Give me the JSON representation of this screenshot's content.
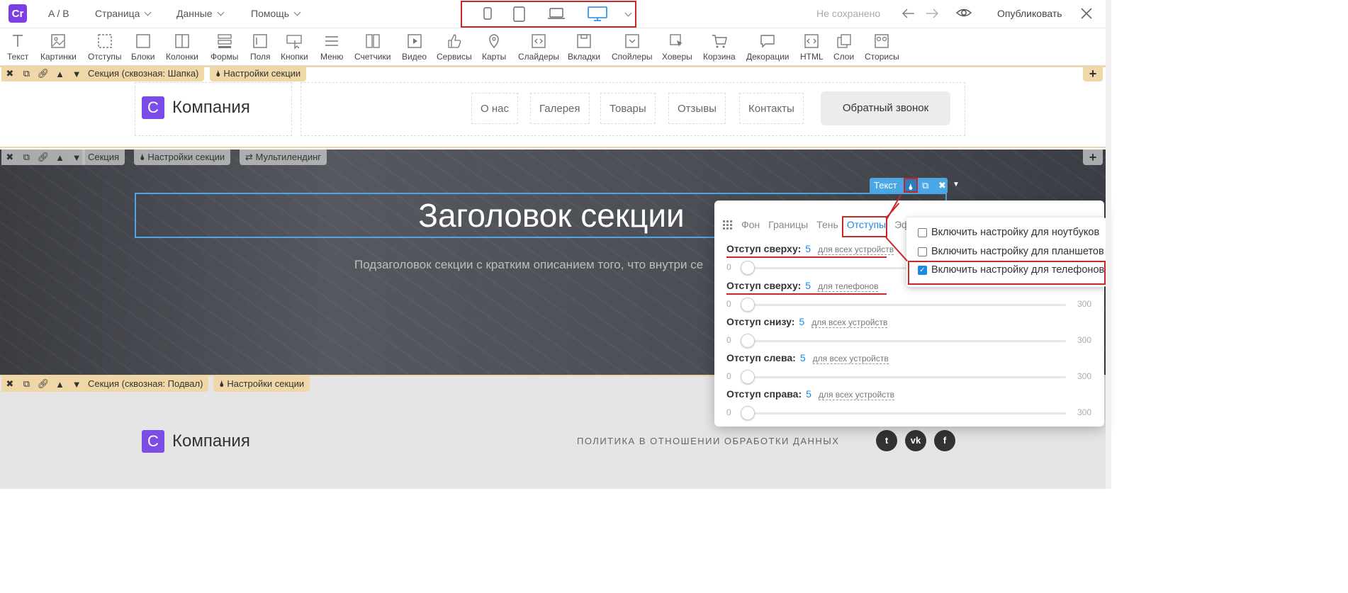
{
  "topbar": {
    "ab": "A / B",
    "menu": [
      "Страница",
      "Данные",
      "Помощь"
    ],
    "save_status": "Не сохранено",
    "publish": "Опубликовать"
  },
  "toolbar": [
    "Текст",
    "Картинки",
    "Отступы",
    "Блоки",
    "Колонки",
    "Формы",
    "Поля",
    "Кнопки",
    "Меню",
    "Счетчики",
    "Видео",
    "Сервисы",
    "Карты",
    "Слайдеры",
    "Вкладки",
    "Спойлеры",
    "Ховеры",
    "Корзина",
    "Декорации",
    "HTML",
    "Слои",
    "Сторисы"
  ],
  "sections": {
    "header_bar": {
      "label": "Секция (сквозная: Шапка)",
      "settings": "Настройки секции"
    },
    "main_bar": {
      "label": "Секция",
      "settings": "Настройки секции",
      "multi": "Мультилендинг"
    },
    "footer_bar": {
      "label": "Секция (сквозная: Подвал)",
      "settings": "Настройки секции"
    }
  },
  "header": {
    "brand": "Компания",
    "brand_mark": "C",
    "nav": [
      "О нас",
      "Галерея",
      "Товары",
      "Отзывы",
      "Контакты"
    ],
    "callback": "Обратный звонок"
  },
  "hero": {
    "title": "Заголовок секции",
    "subtitle": "Подзаголовок секции с кратким описанием того, что внутри се",
    "text_tag": "Текст"
  },
  "footer": {
    "brand": "Компания",
    "policy": "ПОЛИТИКА В ОТНОШЕНИИ ОБРАБОТКИ ДАННЫХ",
    "social": [
      "twitter-icon",
      "vk-icon",
      "facebook-icon"
    ]
  },
  "panel": {
    "tabs": [
      "Фон",
      "Границы",
      "Тень",
      "Отступы",
      "Эф"
    ],
    "active_tab": "Отступы",
    "rows": [
      {
        "label": "Отступ сверху:",
        "value": "5",
        "scope": "для всех устройств",
        "min": "0",
        "max": "300",
        "level": 0.017
      },
      {
        "label": "Отступ сверху:",
        "value": "5",
        "scope": "для телефонов",
        "min": "0",
        "max": "300",
        "level": 0.017
      },
      {
        "label": "Отступ снизу:",
        "value": "5",
        "scope": "для всех устройств",
        "min": "0",
        "max": "300",
        "level": 0.017
      },
      {
        "label": "Отступ слева:",
        "value": "5",
        "scope": "для всех устройств",
        "min": "0",
        "max": "300",
        "level": 0.017
      },
      {
        "label": "Отступ справа:",
        "value": "5",
        "scope": "для всех устройств",
        "min": "0",
        "max": "300",
        "level": 0.017
      }
    ]
  },
  "device_popup": {
    "options": [
      {
        "label": "Включить настройку для ноутбуков",
        "checked": false
      },
      {
        "label": "Включить настройку для планшетов",
        "checked": false
      },
      {
        "label": "Включить настройку для телефонов",
        "checked": true
      }
    ]
  },
  "colors": {
    "accent": "#1e88e5",
    "highlight": "#c62828",
    "section_tag": "#f0d7a8",
    "brand": "#7b4de6"
  }
}
